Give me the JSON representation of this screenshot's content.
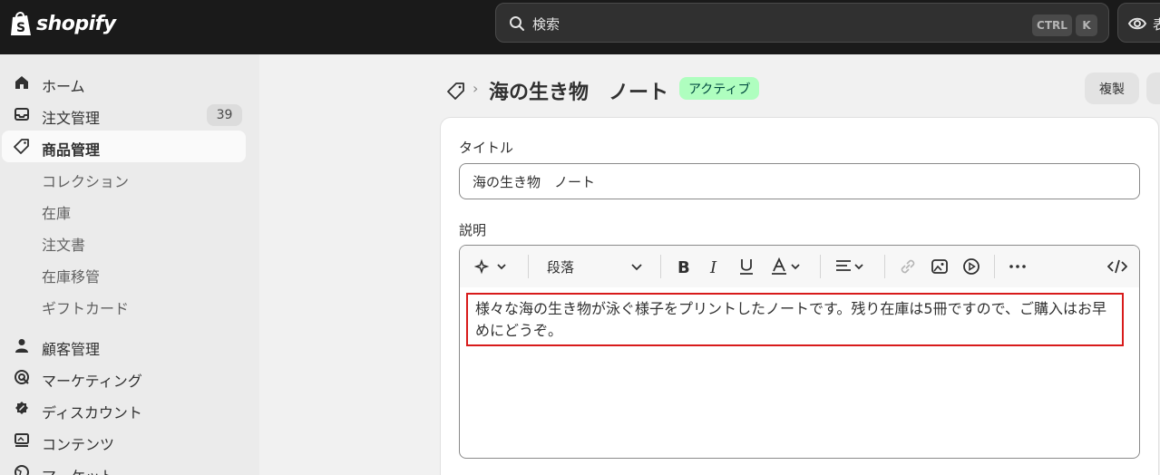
{
  "brand": {
    "name": "shopify"
  },
  "topbar": {
    "search_placeholder": "検索",
    "shortcut_ctrl": "CTRL",
    "shortcut_k": "K",
    "preview_label": "表"
  },
  "sidebar": {
    "items": [
      {
        "label": "ホーム",
        "icon": "home-icon"
      },
      {
        "label": "注文管理",
        "icon": "inbox-icon",
        "badge": "39"
      },
      {
        "label": "商品管理",
        "icon": "tag-icon",
        "active": true
      },
      {
        "label": "コレクション"
      },
      {
        "label": "在庫"
      },
      {
        "label": "注文書"
      },
      {
        "label": "在庫移管"
      },
      {
        "label": "ギフトカード"
      },
      {
        "label": "顧客管理",
        "icon": "person-icon"
      },
      {
        "label": "マーケティング",
        "icon": "target-icon"
      },
      {
        "label": "ディスカウント",
        "icon": "discount-icon"
      },
      {
        "label": "コンテンツ",
        "icon": "content-icon"
      },
      {
        "label": "マーケット",
        "icon": "globe-icon"
      }
    ]
  },
  "header": {
    "title": "海の生き物　ノート",
    "status": "アクティブ",
    "duplicate_label": "複製"
  },
  "form": {
    "title_label": "タイトル",
    "title_value": "海の生き物　ノート",
    "description_label": "説明",
    "paragraph_style": "段落",
    "description_text": "様々な海の生き物が泳ぐ様子をプリントしたノートです。残り在庫は5冊ですので、ご購入はお早めにどうぞ。"
  },
  "colors": {
    "topbar_bg": "#1a1a1a",
    "status_badge_bg": "#affebf",
    "highlight_border": "#d81b1b"
  }
}
